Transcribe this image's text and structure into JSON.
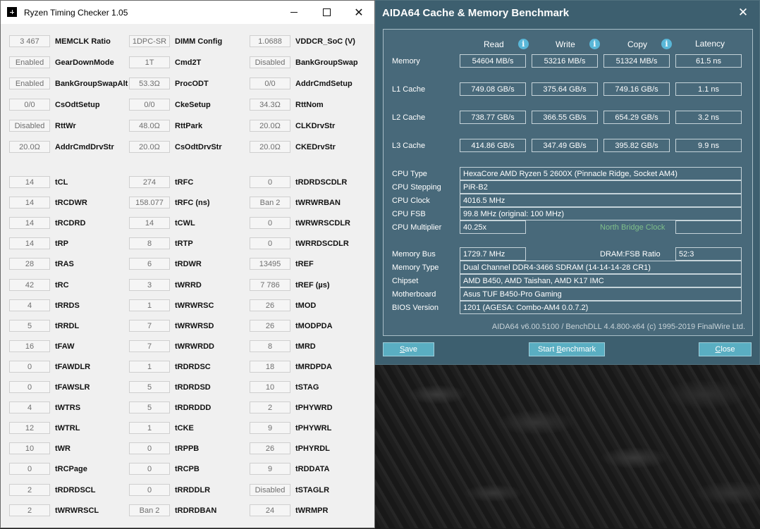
{
  "rtc": {
    "title": "Ryzen Timing Checker 1.05",
    "top_rows": [
      [
        {
          "value": "3 467",
          "label": "MEMCLK Ratio"
        },
        {
          "value": "1DPC-SR",
          "label": "DIMM Config"
        },
        {
          "value": "1.0688",
          "label": "VDDCR_SoC (V)"
        }
      ],
      [
        {
          "value": "Enabled",
          "label": "GearDownMode"
        },
        {
          "value": "1T",
          "label": "Cmd2T"
        },
        {
          "value": "Disabled",
          "label": "BankGroupSwap"
        }
      ],
      [
        {
          "value": "Enabled",
          "label": "BankGroupSwapAlt"
        },
        {
          "value": "53.3Ω",
          "label": "ProcODT"
        },
        {
          "value": "0/0",
          "label": "AddrCmdSetup"
        }
      ],
      [
        {
          "value": "0/0",
          "label": "CsOdtSetup"
        },
        {
          "value": "0/0",
          "label": "CkeSetup"
        },
        {
          "value": "34.3Ω",
          "label": "RttNom"
        }
      ],
      [
        {
          "value": "Disabled",
          "label": "RttWr"
        },
        {
          "value": "48.0Ω",
          "label": "RttPark"
        },
        {
          "value": "20.0Ω",
          "label": "CLKDrvStr"
        }
      ],
      [
        {
          "value": "20.0Ω",
          "label": "AddrCmdDrvStr"
        },
        {
          "value": "20.0Ω",
          "label": "CsOdtDrvStr"
        },
        {
          "value": "20.0Ω",
          "label": "CKEDrvStr"
        }
      ]
    ],
    "timing_rows": [
      [
        {
          "value": "14",
          "label": "tCL"
        },
        {
          "value": "274",
          "label": "tRFC"
        },
        {
          "value": "0",
          "label": "tRDRDSCDLR"
        }
      ],
      [
        {
          "value": "14",
          "label": "tRCDWR"
        },
        {
          "value": "158.077",
          "label": "tRFC (ns)"
        },
        {
          "value": "Ban 2",
          "label": "tWRWRBAN"
        }
      ],
      [
        {
          "value": "14",
          "label": "tRCDRD"
        },
        {
          "value": "14",
          "label": "tCWL"
        },
        {
          "value": "0",
          "label": "tWRWRSCDLR"
        }
      ],
      [
        {
          "value": "14",
          "label": "tRP"
        },
        {
          "value": "8",
          "label": "tRTP"
        },
        {
          "value": "0",
          "label": "tWRRDSCDLR"
        }
      ],
      [
        {
          "value": "28",
          "label": "tRAS"
        },
        {
          "value": "6",
          "label": "tRDWR"
        },
        {
          "value": "13495",
          "label": "tREF"
        }
      ],
      [
        {
          "value": "42",
          "label": "tRC"
        },
        {
          "value": "3",
          "label": "tWRRD"
        },
        {
          "value": "7 786",
          "label": "tREF (µs)"
        }
      ],
      [
        {
          "value": "4",
          "label": "tRRDS"
        },
        {
          "value": "1",
          "label": "tWRWRSC"
        },
        {
          "value": "26",
          "label": "tMOD"
        }
      ],
      [
        {
          "value": "5",
          "label": "tRRDL"
        },
        {
          "value": "7",
          "label": "tWRWRSD"
        },
        {
          "value": "26",
          "label": "tMODPDA"
        }
      ],
      [
        {
          "value": "16",
          "label": "tFAW"
        },
        {
          "value": "7",
          "label": "tWRWRDD"
        },
        {
          "value": "8",
          "label": "tMRD"
        }
      ],
      [
        {
          "value": "0",
          "label": "tFAWDLR"
        },
        {
          "value": "1",
          "label": "tRDRDSC"
        },
        {
          "value": "18",
          "label": "tMRDPDA"
        }
      ],
      [
        {
          "value": "0",
          "label": "tFAWSLR"
        },
        {
          "value": "5",
          "label": "tRDRDSD"
        },
        {
          "value": "10",
          "label": "tSTAG"
        }
      ],
      [
        {
          "value": "4",
          "label": "tWTRS"
        },
        {
          "value": "5",
          "label": "tRDRDDD"
        },
        {
          "value": "2",
          "label": "tPHYWRD"
        }
      ],
      [
        {
          "value": "12",
          "label": "tWTRL"
        },
        {
          "value": "1",
          "label": "tCKE"
        },
        {
          "value": "9",
          "label": "tPHYWRL"
        }
      ],
      [
        {
          "value": "10",
          "label": "tWR"
        },
        {
          "value": "0",
          "label": "tRPPB"
        },
        {
          "value": "26",
          "label": "tPHYRDL"
        }
      ],
      [
        {
          "value": "0",
          "label": "tRCPage"
        },
        {
          "value": "0",
          "label": "tRCPB"
        },
        {
          "value": "9",
          "label": "tRDDATA"
        }
      ],
      [
        {
          "value": "2",
          "label": "tRDRDSCL"
        },
        {
          "value": "0",
          "label": "tRRDDLR"
        },
        {
          "value": "Disabled",
          "label": "tSTAGLR"
        }
      ],
      [
        {
          "value": "2",
          "label": "tWRWRSCL"
        },
        {
          "value": "Ban 2",
          "label": "tRDRDBAN"
        },
        {
          "value": "24",
          "label": "tWRMPR"
        }
      ]
    ]
  },
  "aida": {
    "title": "AIDA64 Cache & Memory Benchmark",
    "columns": {
      "read": "Read",
      "write": "Write",
      "copy": "Copy",
      "latency": "Latency"
    },
    "rows": [
      {
        "label": "Memory",
        "read": "54604 MB/s",
        "write": "53216 MB/s",
        "copy": "51324 MB/s",
        "latency": "61.5 ns"
      },
      {
        "label": "L1 Cache",
        "read": "749.08 GB/s",
        "write": "375.64 GB/s",
        "copy": "749.16 GB/s",
        "latency": "1.1 ns"
      },
      {
        "label": "L2 Cache",
        "read": "738.77 GB/s",
        "write": "366.55 GB/s",
        "copy": "654.29 GB/s",
        "latency": "3.2 ns"
      },
      {
        "label": "L3 Cache",
        "read": "414.86 GB/s",
        "write": "347.49 GB/s",
        "copy": "395.82 GB/s",
        "latency": "9.9 ns"
      }
    ],
    "cpu": {
      "type_label": "CPU Type",
      "type": "HexaCore AMD Ryzen 5 2600X  (Pinnacle Ridge, Socket AM4)",
      "stepping_label": "CPU Stepping",
      "stepping": "PiR-B2",
      "clock_label": "CPU Clock",
      "clock": "4016.5 MHz",
      "fsb_label": "CPU FSB",
      "fsb": "99.8 MHz  (original: 100 MHz)",
      "multiplier_label": "CPU Multiplier",
      "multiplier": "40.25x",
      "nb_clock_label": "North Bridge Clock",
      "nb_clock": ""
    },
    "memory": {
      "bus_label": "Memory Bus",
      "bus": "1729.7 MHz",
      "ratio_label": "DRAM:FSB Ratio",
      "ratio": "52:3",
      "type_label": "Memory Type",
      "type": "Dual Channel DDR4-3466 SDRAM  (14-14-14-28 CR1)",
      "chipset_label": "Chipset",
      "chipset": "AMD B450, AMD Taishan, AMD K17 IMC",
      "motherboard_label": "Motherboard",
      "motherboard": "Asus TUF B450-Pro Gaming",
      "bios_label": "BIOS Version",
      "bios": "1201  (AGESA: Combo-AM4 0.0.7.2)"
    },
    "footer": "AIDA64 v6.00.5100 / BenchDLL 4.4.800-x64  (c) 1995-2019 FinalWire Ltd.",
    "buttons": {
      "save": "Save",
      "start": "Start Benchmark",
      "close": "Close"
    }
  }
}
